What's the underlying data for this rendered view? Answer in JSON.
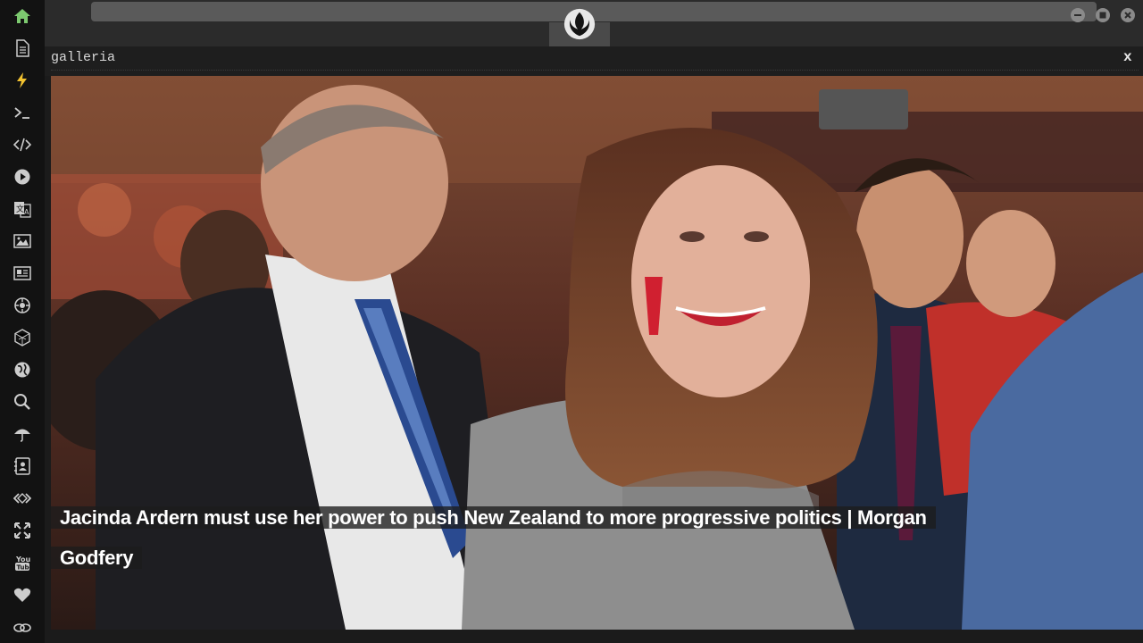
{
  "sidebar": {
    "icons": [
      "home-icon",
      "document-icon",
      "lightning-icon",
      "terminal-icon",
      "code-icon",
      "play-icon",
      "translate-icon",
      "image-icon",
      "news-icon",
      "settings-icon",
      "cube-icon",
      "globe-icon",
      "search-icon",
      "umbrella-icon",
      "contacts-icon",
      "dev-icon",
      "expand-icon",
      "youtube-icon",
      "heart-icon",
      "link-icon"
    ],
    "accent": "#7cc96f"
  },
  "topbar": {
    "logo": "rebel-alliance-icon",
    "buttons": [
      "minimize-icon",
      "maximize-icon",
      "close-icon"
    ]
  },
  "panel": {
    "title": "galleria",
    "close_label": "x"
  },
  "gallery": {
    "caption": "Jacinda Ardern must use her power to push New Zealand to more progressive politics | Morgan Godfery"
  }
}
